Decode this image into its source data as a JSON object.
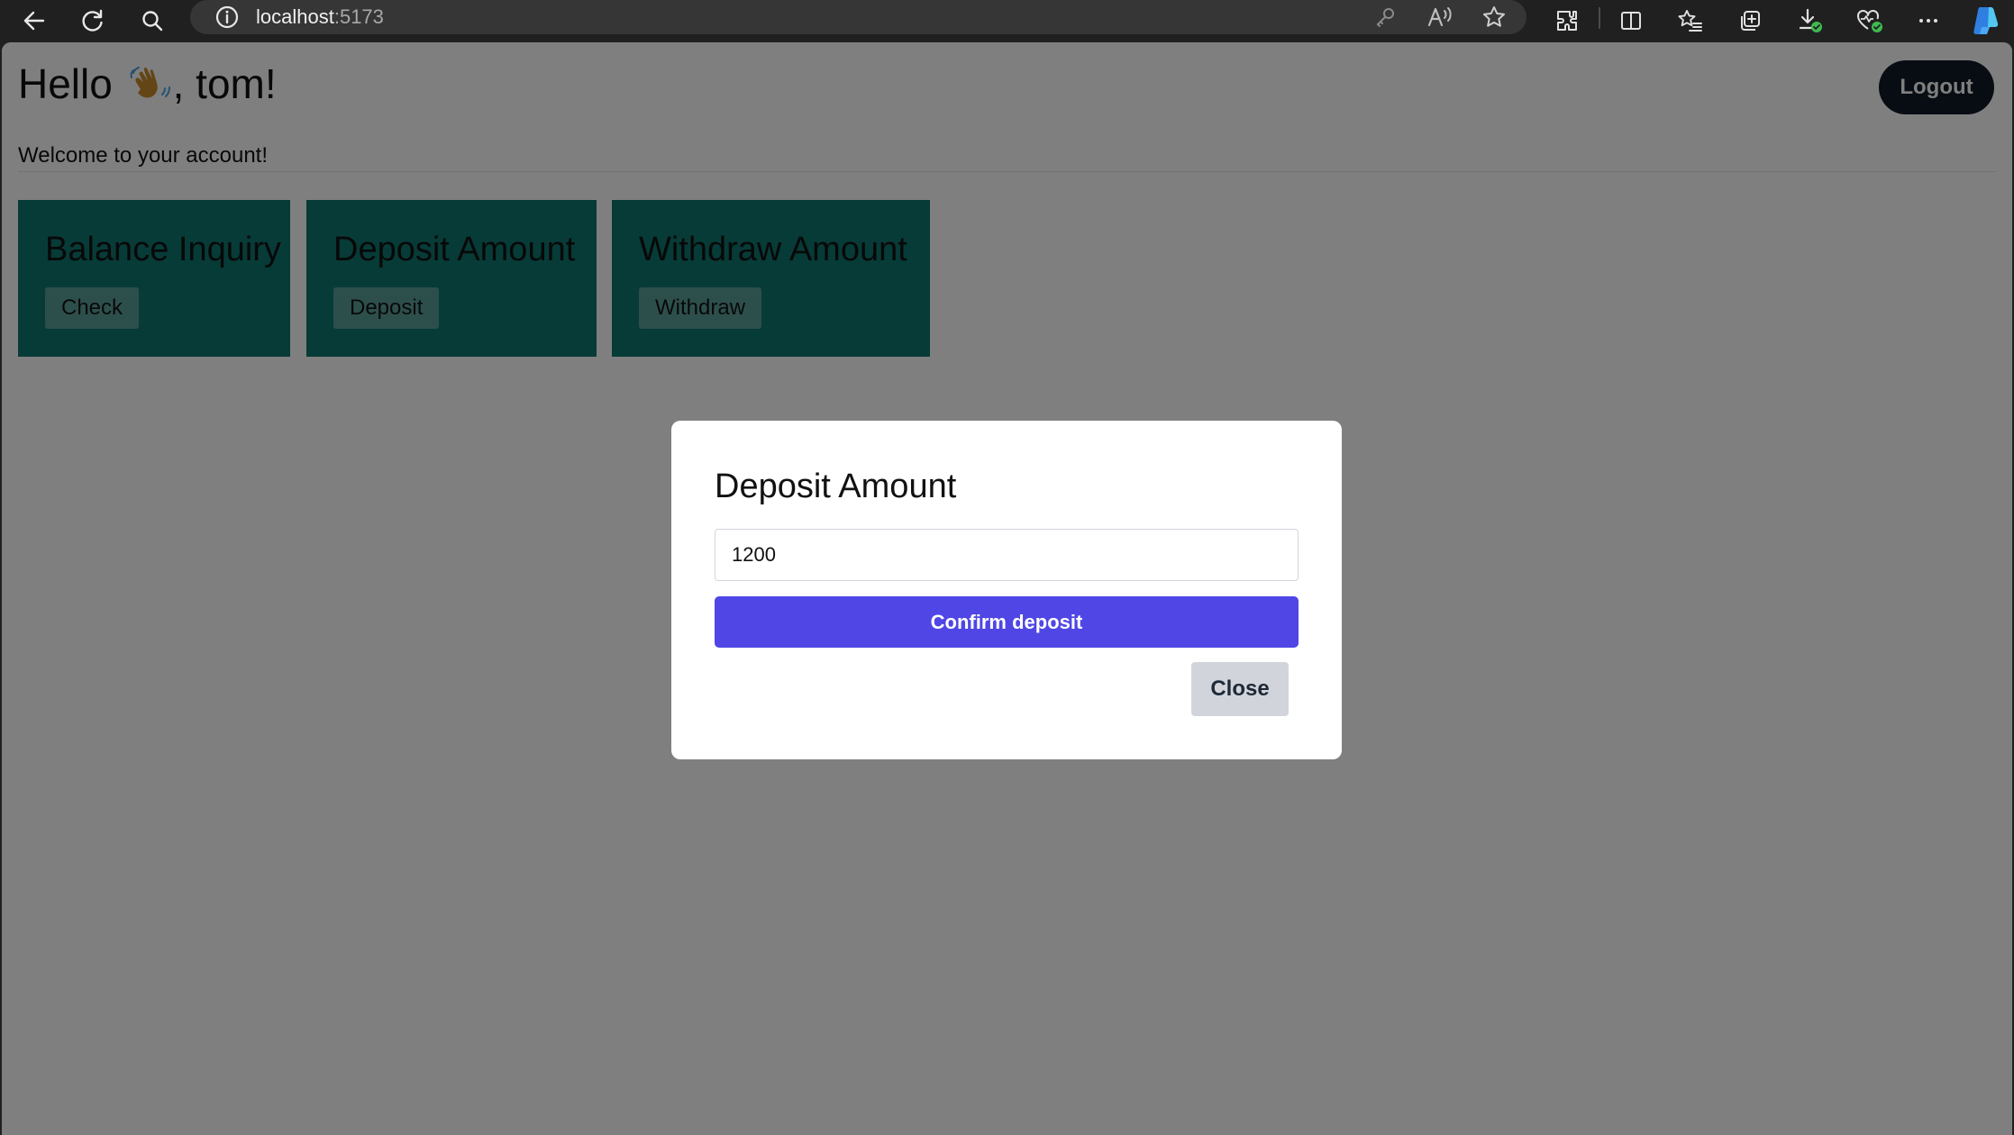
{
  "browser": {
    "url_host": "localhost",
    "url_port": ":5173",
    "icons": [
      "back-icon",
      "refresh-icon",
      "search-icon",
      "info-icon",
      "password-key-icon",
      "read-aloud-icon",
      "favorite-star-icon",
      "extensions-icon",
      "split-screen-icon",
      "favorites-list-icon",
      "collections-icon",
      "downloads-icon",
      "browser-essentials-icon",
      "more-icon",
      "copilot-icon"
    ]
  },
  "page": {
    "greeting_prefix": "Hello",
    "greeting_suffix": ", tom!",
    "greeting_emoji": "waving-hand-icon",
    "logout_label": "Logout",
    "welcome_text": "Welcome to your account!",
    "cards": [
      {
        "title": "Balance Inquiry",
        "button": "Check"
      },
      {
        "title": "Deposit Amount",
        "button": "Deposit"
      },
      {
        "title": "Withdraw Amount",
        "button": "Withdraw"
      }
    ],
    "card_color": "#0f766e"
  },
  "modal": {
    "title": "Deposit Amount",
    "input_value": "1200",
    "confirm_label": "Confirm deposit",
    "close_label": "Close",
    "confirm_color": "#4f46e5"
  }
}
